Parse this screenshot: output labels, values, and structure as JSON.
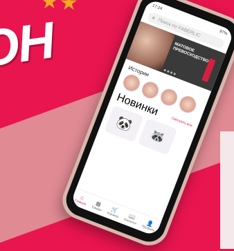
{
  "headline": "ОН",
  "status": {
    "time": "17:24",
    "battery": "97%"
  },
  "search": {
    "placeholder": "Поиск по FABERLIC"
  },
  "banner": {
    "title": "МАТОВОЕ ПРЕВОСХОДСТВО"
  },
  "sections": {
    "stories": "Истории",
    "novelties": "Новинки",
    "see_all": "Смотреть все"
  },
  "tabs": [
    {
      "label": "Главная",
      "icon": "home-icon",
      "active": true
    },
    {
      "label": "Товары",
      "icon": "grid-icon",
      "active": false
    },
    {
      "label": "Корзина",
      "icon": "cart-icon",
      "active": false
    },
    {
      "label": "Каталоги",
      "icon": "book-icon",
      "active": false
    },
    {
      "label": "Профиль",
      "icon": "user-icon",
      "active": false
    }
  ],
  "colors": {
    "accent": "#e8154f",
    "background": "#e8154f",
    "stripe": "#e08a94"
  }
}
